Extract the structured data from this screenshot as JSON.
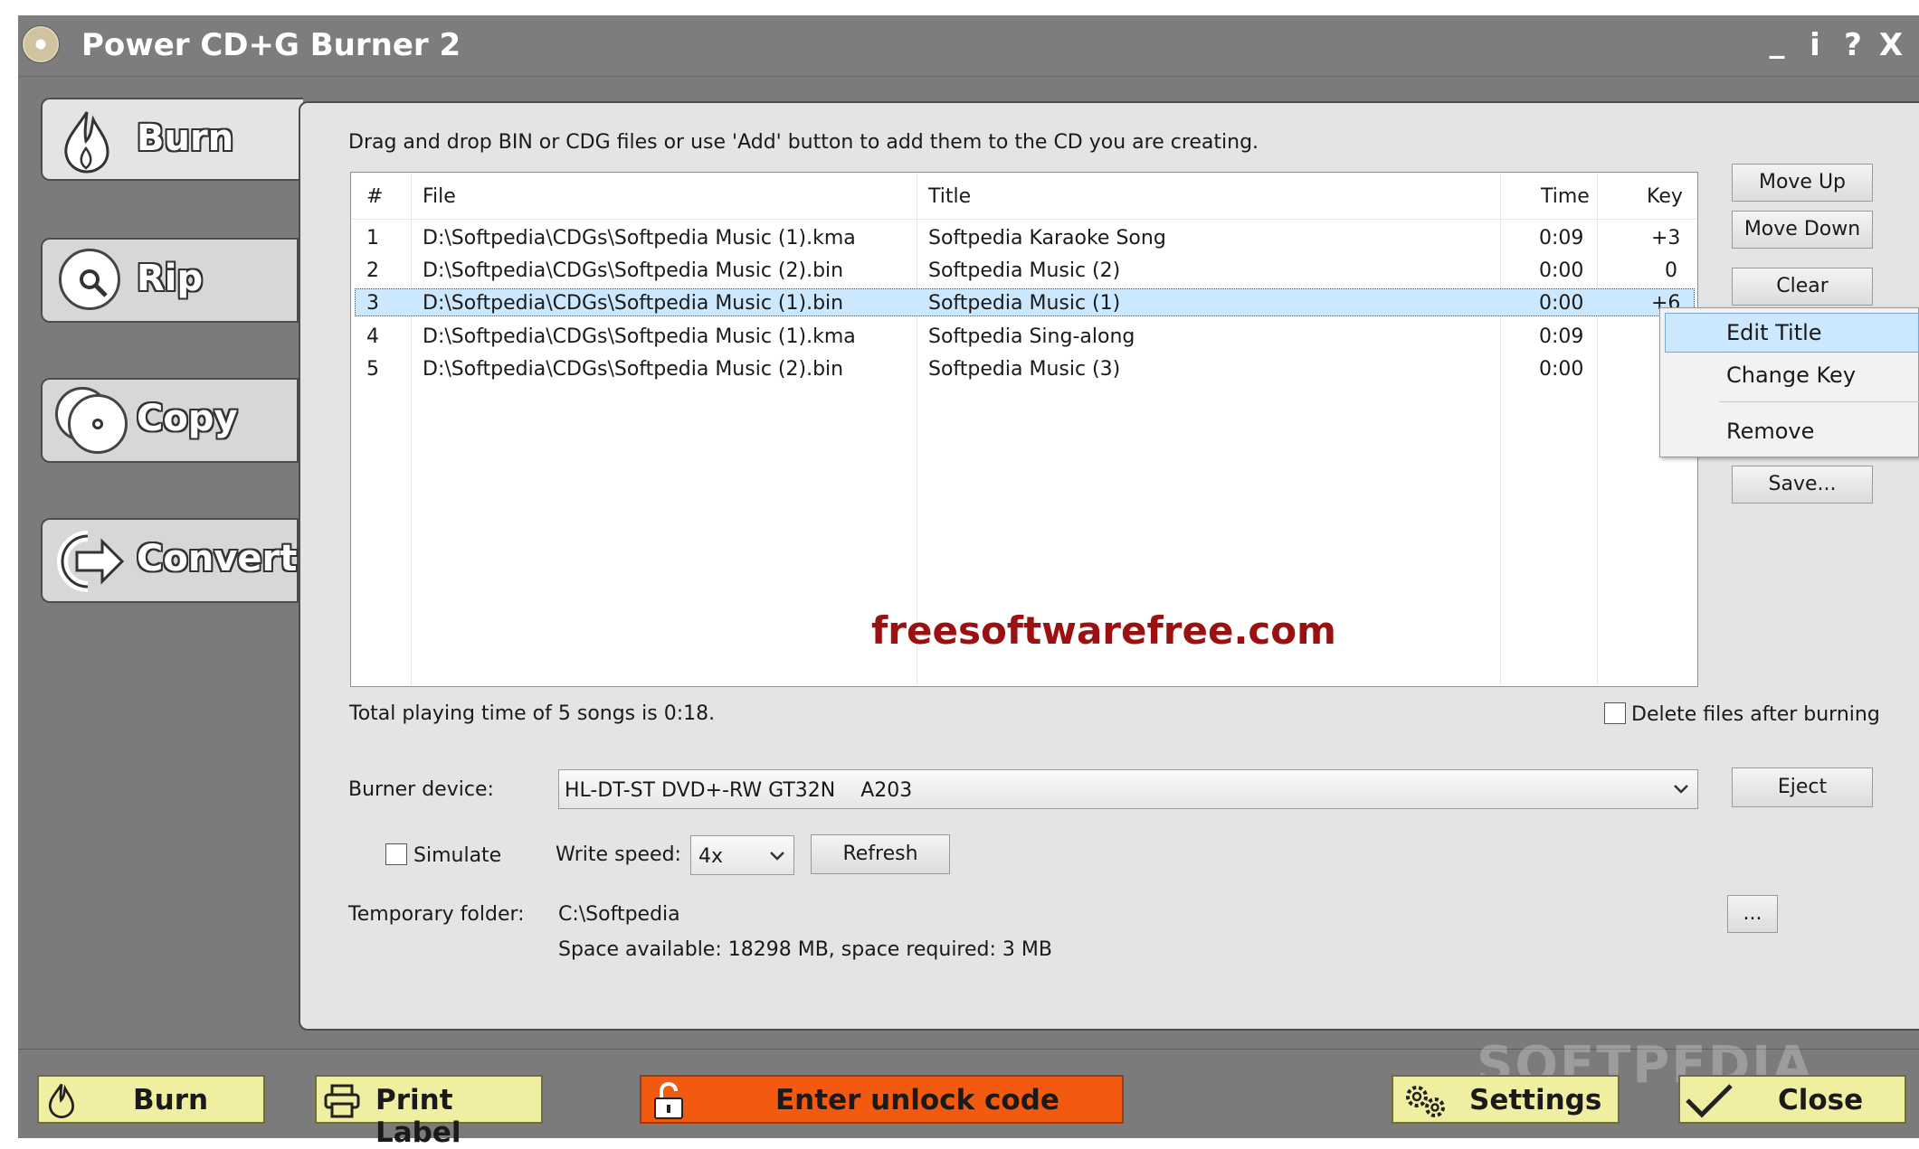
{
  "app": {
    "title": "Power CD+G Burner 2",
    "controls": {
      "minimize": "_",
      "info": "i",
      "help": "?",
      "close": "X"
    }
  },
  "nav": {
    "burn": "Burn",
    "rip": "Rip",
    "copy": "Copy",
    "convert": "Convert"
  },
  "burn_panel": {
    "instruction": "Drag and drop BIN or CDG files or use 'Add' button to add them to the CD you are creating.",
    "columns": {
      "num": "#",
      "file": "File",
      "title": "Title",
      "time": "Time",
      "key": "Key"
    },
    "rows": [
      {
        "num": "1",
        "file": "D:\\Softpedia\\CDGs\\Softpedia Music (1).kma",
        "title": "Softpedia Karaoke Song",
        "time": "0:09",
        "key": "+3"
      },
      {
        "num": "2",
        "file": "D:\\Softpedia\\CDGs\\Softpedia Music (2).bin",
        "title": "Softpedia Music (2)",
        "time": "0:00",
        "key": "0"
      },
      {
        "num": "3",
        "file": "D:\\Softpedia\\CDGs\\Softpedia Music (1).bin",
        "title": "Softpedia Music (1)",
        "time": "0:00",
        "key": "+6"
      },
      {
        "num": "4",
        "file": "D:\\Softpedia\\CDGs\\Softpedia Music (1).kma",
        "title": "Softpedia Sing-along",
        "time": "0:09",
        "key": ""
      },
      {
        "num": "5",
        "file": "D:\\Softpedia\\CDGs\\Softpedia Music (2).bin",
        "title": "Softpedia Music (3)",
        "time": "0:00",
        "key": ""
      }
    ],
    "watermark": "freesoftwarefree.com",
    "side_buttons": {
      "move_up": "Move Up",
      "move_down": "Move Down",
      "clear": "Clear",
      "save": "Save..."
    },
    "context_menu": {
      "edit_title": "Edit Title",
      "change_key": "Change Key",
      "remove": "Remove"
    },
    "total_time": "Total playing time of 5 songs is 0:18.",
    "delete_files_label": "Delete files after burning",
    "burner_label": "Burner device:",
    "burner_value": "HL-DT-ST DVD+-RW GT32N    A203",
    "eject": "Eject",
    "simulate_label": "Simulate",
    "write_speed_label": "Write speed:",
    "write_speed_value": "4x",
    "refresh": "Refresh",
    "temp_folder_label": "Temporary folder:",
    "temp_folder_value": "C:\\Softpedia",
    "space_info": "Space available: 18298 MB, space required: 3 MB",
    "browse": "..."
  },
  "bottom": {
    "burn": "Burn",
    "print_label": "Print Label",
    "unlock": "Enter unlock code",
    "settings": "Settings",
    "close": "Close",
    "softpedia_watermark": "SOFTPEDIA"
  },
  "colors": {
    "chrome": "#7b7b7b",
    "panel": "#e4e4e4",
    "selection": "#cce8ff",
    "bottom_button": "#f0eea0",
    "unlock_button": "#f25a12",
    "watermark": "#9b1010"
  },
  "icons": {
    "app": "cd-icon",
    "burn": "flame-icon",
    "rip": "magnify-cd-icon",
    "copy": "two-cd-icon",
    "convert": "arrow-right-icon",
    "print": "printer-icon",
    "unlock": "padlock-icon",
    "settings": "gears-icon",
    "close": "checkmark-icon"
  }
}
